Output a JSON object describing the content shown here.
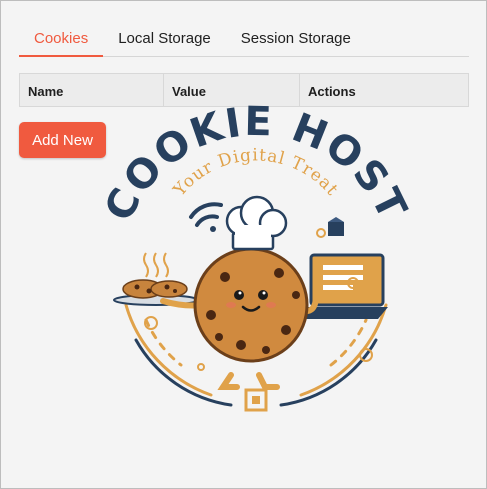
{
  "tabs": [
    {
      "label": "Cookies",
      "active": true
    },
    {
      "label": "Local Storage",
      "active": false
    },
    {
      "label": "Session Storage",
      "active": false
    }
  ],
  "table": {
    "columns": [
      "Name",
      "Value",
      "Actions"
    ]
  },
  "add_button": {
    "label": "Add New"
  },
  "logo": {
    "title": "COOKIE HOST",
    "tagline": "Your Digital Treat"
  },
  "colors": {
    "accent": "#f05a3f",
    "logo_navy": "#27405e",
    "logo_gold": "#e0a24a",
    "cookie_brown": "#c8843d"
  }
}
